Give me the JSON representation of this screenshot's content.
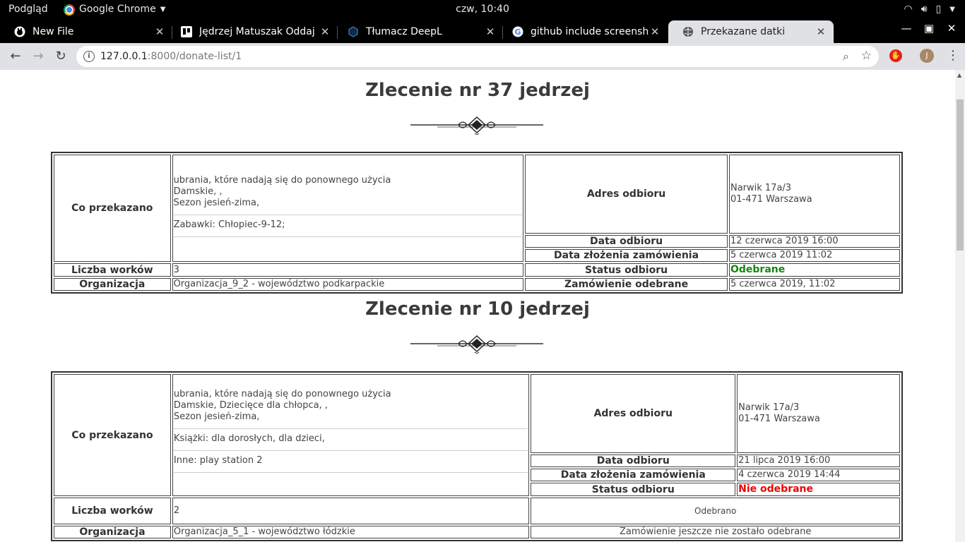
{
  "os": {
    "app_name": "Podgląd",
    "browser_name": "Google Chrome",
    "clock": "czw, 10:40"
  },
  "tabs": [
    {
      "title": "New File",
      "icon": "github-icon"
    },
    {
      "title": "Jędrzej Matuszak Oddaj r",
      "icon": "trello-icon"
    },
    {
      "title": "Tłumacz DeepL",
      "icon": "deepl-icon"
    },
    {
      "title": "github include screensho",
      "icon": "google-icon"
    },
    {
      "title": "Przekazane datki",
      "icon": "globe-icon",
      "active": true
    }
  ],
  "address_bar": {
    "host": "127.0.0.1",
    "path": ":8000/donate-list/1"
  },
  "profile_initial": "J",
  "orders": [
    {
      "title": "Zlecenie nr 37 jedrzej",
      "labels": {
        "what": "Co przekazano",
        "bags": "Liczba worków",
        "organization": "Organizacja",
        "address": "Adres odbioru",
        "pickup_date": "Data odbioru",
        "order_date": "Data złożenia zamówienia",
        "status": "Status odbioru",
        "received": "Zamówienie odebrane"
      },
      "gifts": [
        {
          "lines": [
            "ubrania, które nadają się do ponownego użycia",
            "Damskie, ,",
            "Sezon jesień-zima,"
          ]
        },
        {
          "lines": [
            "Zabawki: Chłopiec-9-12;"
          ]
        }
      ],
      "address": [
        "Narwik 17a/3",
        "01-471 Warszawa"
      ],
      "pickup_date": "12 czerwca 2019 16:00",
      "order_date": "5 czerwca 2019 11:02",
      "status": "Odebrane",
      "bags": "3",
      "organization": "Organizacja_9_2 - województwo podkarpackie",
      "received_date": "5 czerwca 2019, 11:02"
    },
    {
      "title": "Zlecenie nr 10 jedrzej",
      "labels": {
        "what": "Co przekazano",
        "bags": "Liczba worków",
        "organization": "Organizacja",
        "address": "Adres odbioru",
        "pickup_date": "Data odbioru",
        "order_date": "Data złożenia zamówienia",
        "status": "Status odbioru"
      },
      "gifts": [
        {
          "lines": [
            "ubrania, które nadają się do ponownego użycia",
            "Damskie, Dziecięce dla chłopca, ,",
            "Sezon jesień-zima,"
          ]
        },
        {
          "lines": [
            "Książki: dla dorosłych, dla dzieci,"
          ]
        },
        {
          "lines": [
            "Inne: play station 2"
          ]
        }
      ],
      "address": [
        "Narwik 17a/3",
        "01-471 Warszawa"
      ],
      "pickup_date": "21 lipca 2019 16:00",
      "order_date": "4 czerwca 2019 14:44",
      "status": "Nie odebrane",
      "bags": "2",
      "organization": "Organizacja_5_1 - województwo łódzkie",
      "mark_received_button": "Odebrano",
      "not_received_note": "Zamówienie jeszcze nie zostało odebrane"
    }
  ],
  "joined": {
    "address_0": "Narwik 17a/3\n01-471 Warszawa",
    "address_1": "Narwik 17a/3\n01-471 Warszawa",
    "gift0_0": "ubrania, które nadają się do ponownego użycia\nDamskie, ,\nSezon jesień-zima,",
    "gift0_1": "Zabawki: Chłopiec-9-12;",
    "gift1_0": "ubrania, które nadają się do ponownego użycia\nDamskie, Dziecięce dla chłopca, ,\nSezon jesień-zima,",
    "gift1_1": "Książki: dla dorosłych, dla dzieci,",
    "gift1_2": "Inne: play station 2"
  }
}
